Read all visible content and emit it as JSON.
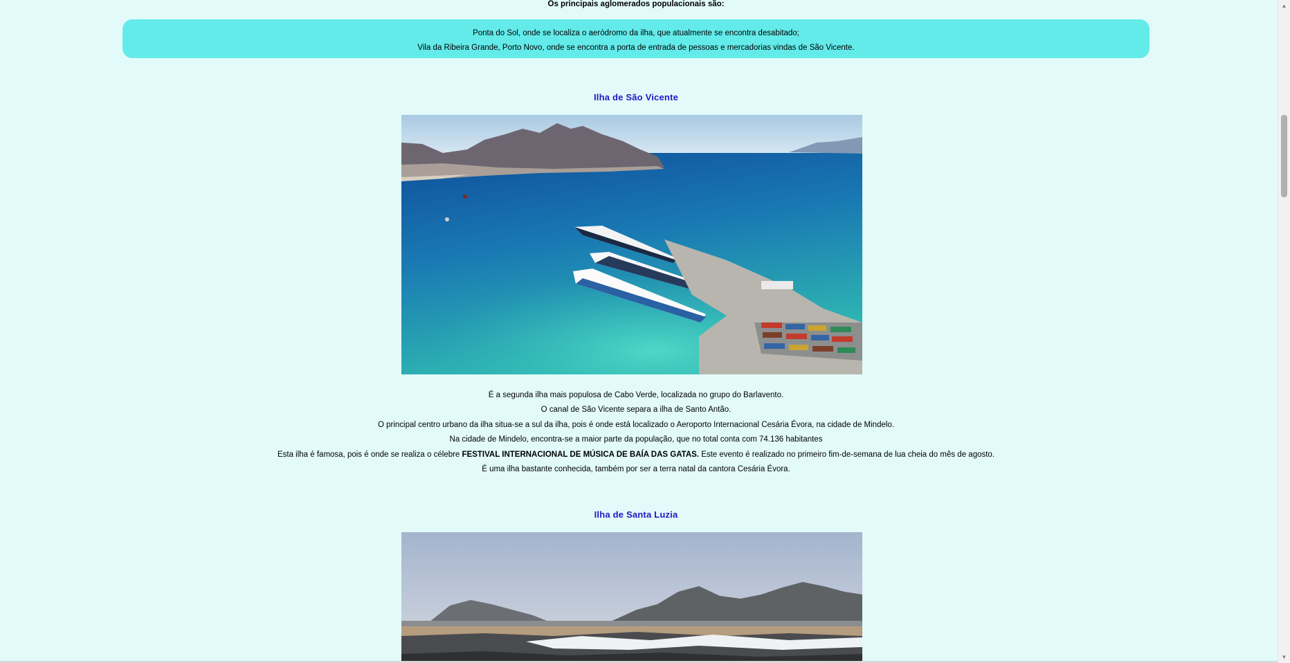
{
  "intro": {
    "heading": "Os principais aglomerados populacionais são:",
    "list": [
      "Ponta do Sol, onde se localiza o aeródromo da ilha, que atualmente se encontra desabitado;",
      "Vila da Ribeira Grande, Porto Novo, onde se encontra a porta de entrada de pessoas e mercadorias vindas de São Vicente."
    ]
  },
  "sao_vicente": {
    "title": "Ilha de São Vicente",
    "image_alt": "harbor-with-cruise-ships",
    "paragraphs": [
      "É a segunda ilha mais populosa de Cabo Verde, localizada no grupo do Barlavento.",
      "O canal de São Vicente separa a ilha de Santo Antão.",
      "O principal centro urbano da ilha situa-se a sul da ilha, pois é onde está localizado o Aeroporto Internacional Cesária Évora, na cidade de Mindelo.",
      "Na cidade de Mindelo, encontra-se a maior parte da população, que no total conta com 74.136 habitantes"
    ],
    "festival": {
      "before": "Esta ilha é famosa, pois é onde se realiza o célebre ",
      "bold": "FESTIVAL INTERNACIONAL DE MÚSICA DE BAÍA DAS GATAS.",
      "after": " Este evento é realizado no primeiro fim-de-semana de lua cheia do mês de agosto."
    },
    "last_paragraph": "É uma ilha bastante conhecida, também por ser a terra natal da cantora Cesária Évora."
  },
  "santa_luzia": {
    "title": "Ilha de Santa Luzia",
    "image_alt": "rocky-coast-with-mountains"
  },
  "colors": {
    "background": "#e2fbfa",
    "highlight": "#63ebea",
    "title": "#2117c7"
  }
}
